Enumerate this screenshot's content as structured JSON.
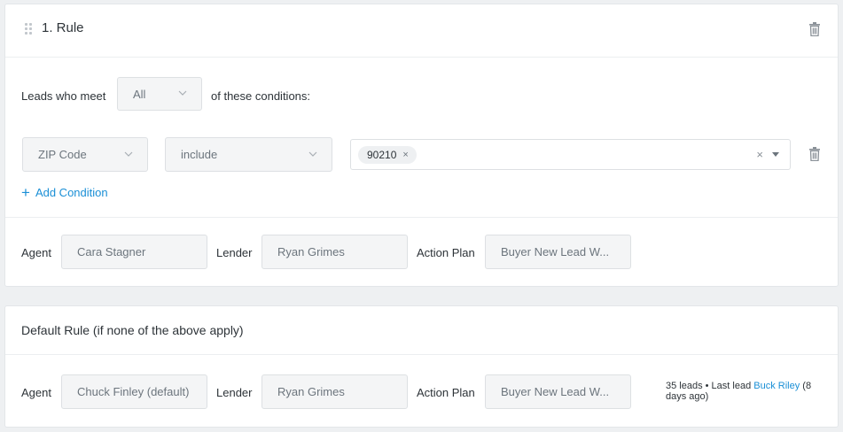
{
  "rule": {
    "title": "1. Rule",
    "match_prefix": "Leads who meet",
    "match_value": "All",
    "match_suffix": "of these conditions:",
    "condition": {
      "field": "ZIP Code",
      "operator": "include",
      "tags": [
        "90210"
      ],
      "tag_remove_glyph": "×",
      "clear_glyph": "×"
    },
    "add_condition_label": "Add Condition",
    "agent_label": "Agent",
    "agent_value": "Cara Stagner",
    "lender_label": "Lender",
    "lender_value": "Ryan Grimes",
    "action_plan_label": "Action Plan",
    "action_plan_value": "Buyer New Lead W..."
  },
  "default_rule": {
    "title": "Default Rule (if none of the above apply)",
    "agent_label": "Agent",
    "agent_value": "Chuck Finley (default)",
    "lender_label": "Lender",
    "lender_value": "Ryan Grimes",
    "action_plan_label": "Action Plan",
    "action_plan_value": "Buyer New Lead W...",
    "stats_prefix": "35 leads • Last lead ",
    "stats_link": "Buck Riley",
    "stats_suffix": " (8 days ago)"
  },
  "icons": {
    "drag": "drag-handle-icon",
    "trash": "trash-icon",
    "chevron": "chevron-down-icon",
    "plus": "plus-icon",
    "clear": "clear-icon",
    "caret": "caret-down-icon"
  },
  "colors": {
    "accent": "#1a8fd6",
    "background": "#eef0f2",
    "field_bg": "#f4f5f6"
  }
}
